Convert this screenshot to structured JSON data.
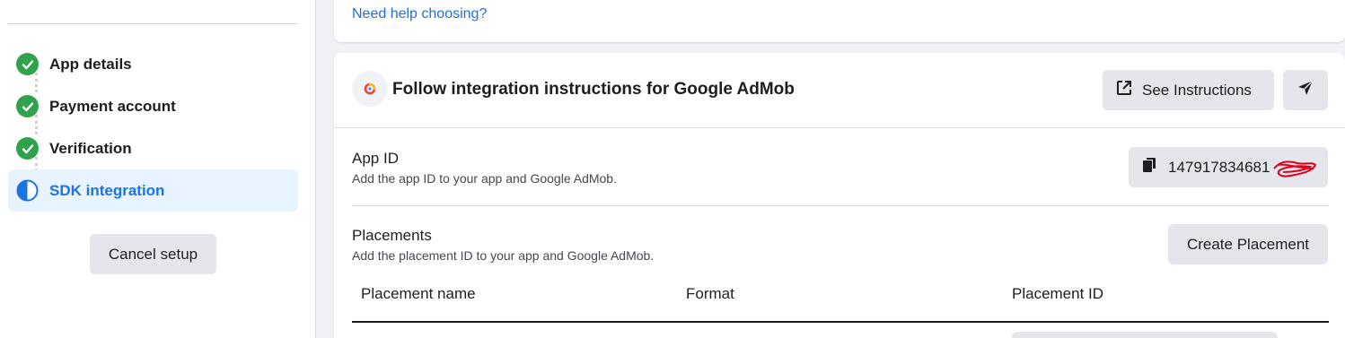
{
  "sidebar": {
    "steps": [
      {
        "label": "App details",
        "status": "complete"
      },
      {
        "label": "Payment account",
        "status": "complete"
      },
      {
        "label": "Verification",
        "status": "complete"
      },
      {
        "label": "SDK integration",
        "status": "in-progress"
      }
    ],
    "cancel_label": "Cancel setup"
  },
  "top_card": {
    "help_link": "Need help choosing?"
  },
  "integration": {
    "title": "Follow integration instructions for Google AdMob",
    "see_instructions_label": "See Instructions",
    "app_id": {
      "title": "App ID",
      "description": "Add the app ID to your app and Google AdMob.",
      "value": "147917834681"
    },
    "placements": {
      "title": "Placements",
      "description": "Add the placement ID to your app and Google AdMob.",
      "create_label": "Create Placement",
      "columns": [
        "Placement name",
        "Format",
        "Placement ID"
      ]
    }
  },
  "colors": {
    "complete": "#31a24c",
    "accent": "#1b74e4",
    "button_bg": "#e4e6eb",
    "active_bg": "#e7f3ff"
  }
}
